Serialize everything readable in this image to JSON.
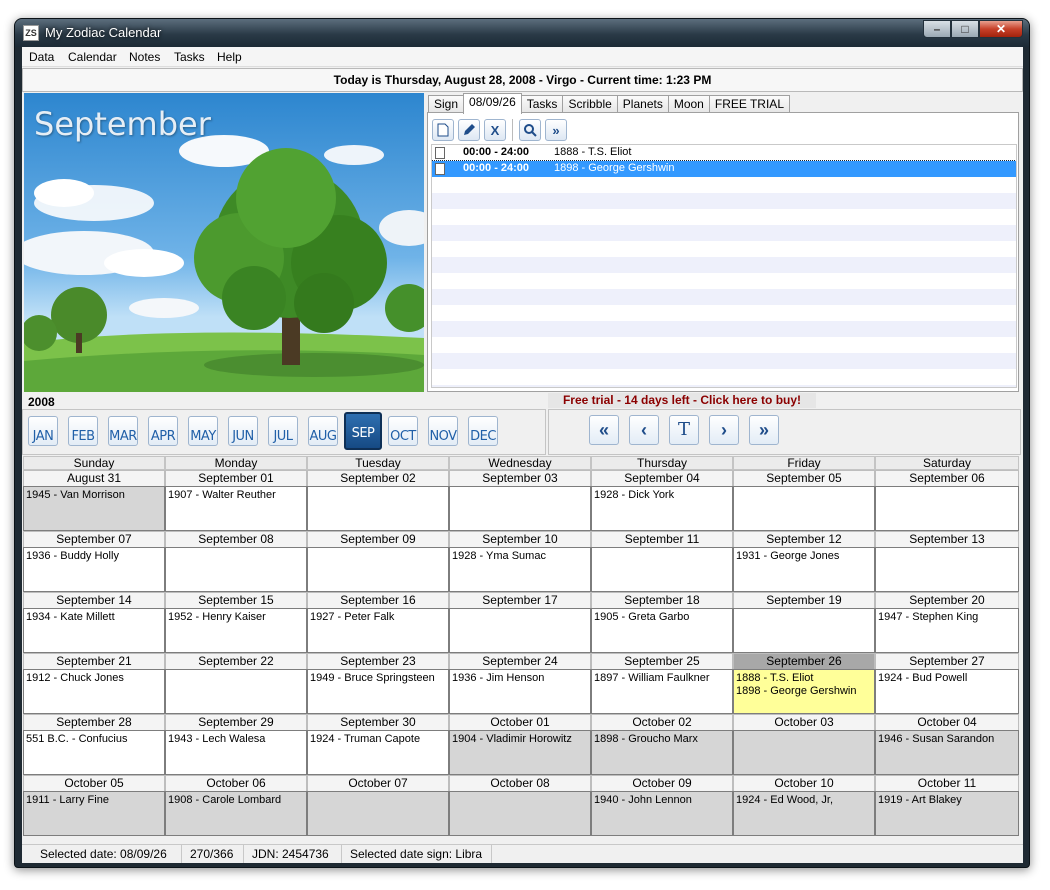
{
  "window": {
    "title": "My Zodiac Calendar",
    "icon_text": "ZS",
    "min": "–",
    "max": "□",
    "close": "✕"
  },
  "menu": [
    "Data",
    "Calendar",
    "Notes",
    "Tasks",
    "Help"
  ],
  "today_bar": "Today is Thursday, August 28, 2008 - Virgo - Current time: 1:23 PM",
  "photo": {
    "title": "September"
  },
  "tabs": [
    "Sign",
    "08/09/26",
    "Tasks",
    "Scribble",
    "Planets",
    "Moon",
    "FREE TRIAL"
  ],
  "active_tab": 1,
  "toolbar_icons": [
    "new-icon",
    "edit-icon",
    "delete-icon",
    "search-icon",
    "more-icon"
  ],
  "events": [
    {
      "time": "00:00 - 24:00",
      "text": "1888 - T.S. Eliot",
      "selected": false
    },
    {
      "time": "00:00 - 24:00",
      "text": "1898 - George Gershwin",
      "selected": true
    }
  ],
  "year": "2008",
  "trial_text": "Free trial - 14 days left - Click here to buy!",
  "months": [
    "JAN",
    "FEB",
    "MAR",
    "APR",
    "MAY",
    "JUN",
    "JUL",
    "AUG",
    "SEP",
    "OCT",
    "NOV",
    "DEC"
  ],
  "active_month": 8,
  "nav": {
    "first": "«",
    "prev": "‹",
    "today": "T",
    "next": "›",
    "last": "»"
  },
  "weekdays": [
    "Sunday",
    "Monday",
    "Tuesday",
    "Wednesday",
    "Thursday",
    "Friday",
    "Saturday"
  ],
  "weeks": [
    [
      {
        "date": "August 31",
        "text": "1945 - Van Morrison",
        "other": true
      },
      {
        "date": "September 01",
        "text": "1907 - Walter Reuther"
      },
      {
        "date": "September 02",
        "text": ""
      },
      {
        "date": "September 03",
        "text": ""
      },
      {
        "date": "September 04",
        "text": "1928 - Dick York"
      },
      {
        "date": "September 05",
        "text": ""
      },
      {
        "date": "September 06",
        "text": ""
      }
    ],
    [
      {
        "date": "September 07",
        "text": "1936 - Buddy Holly"
      },
      {
        "date": "September 08",
        "text": ""
      },
      {
        "date": "September 09",
        "text": ""
      },
      {
        "date": "September 10",
        "text": "1928 - Yma Sumac"
      },
      {
        "date": "September 11",
        "text": ""
      },
      {
        "date": "September 12",
        "text": "1931 - George Jones"
      },
      {
        "date": "September 13",
        "text": ""
      }
    ],
    [
      {
        "date": "September 14",
        "text": "1934 - Kate Millett"
      },
      {
        "date": "September 15",
        "text": "1952 - Henry Kaiser"
      },
      {
        "date": "September 16",
        "text": "1927 - Peter Falk"
      },
      {
        "date": "September 17",
        "text": ""
      },
      {
        "date": "September 18",
        "text": "1905 - Greta Garbo"
      },
      {
        "date": "September 19",
        "text": ""
      },
      {
        "date": "September 20",
        "text": "1947 - Stephen King"
      }
    ],
    [
      {
        "date": "September 21",
        "text": "1912 - Chuck Jones"
      },
      {
        "date": "September 22",
        "text": ""
      },
      {
        "date": "September 23",
        "text": "1949 - Bruce Springsteen"
      },
      {
        "date": "September 24",
        "text": "1936 - Jim Henson"
      },
      {
        "date": "September 25",
        "text": "1897 - William Faulkner"
      },
      {
        "date": "September 26",
        "text": "1888 - T.S. Eliot",
        "text2": "1898 - George Gershwin",
        "selected": true
      },
      {
        "date": "September 27",
        "text": "1924 - Bud Powell"
      }
    ],
    [
      {
        "date": "September 28",
        "text": "551 B.C. - Confucius"
      },
      {
        "date": "September 29",
        "text": "1943 - Lech Walesa"
      },
      {
        "date": "September 30",
        "text": "1924 - Truman Capote"
      },
      {
        "date": "October 01",
        "text": "1904 - Vladimir Horowitz",
        "other": true
      },
      {
        "date": "October 02",
        "text": "1898 - Groucho Marx",
        "other": true
      },
      {
        "date": "October 03",
        "text": "",
        "other": true
      },
      {
        "date": "October 04",
        "text": "1946 - Susan Sarandon",
        "other": true
      }
    ],
    [
      {
        "date": "October 05",
        "text": "1911 - Larry Fine",
        "other": true
      },
      {
        "date": "October 06",
        "text": "1908 - Carole Lombard",
        "other": true
      },
      {
        "date": "October 07",
        "text": "",
        "other": true
      },
      {
        "date": "October 08",
        "text": "",
        "other": true
      },
      {
        "date": "October 09",
        "text": "1940 - John Lennon",
        "other": true
      },
      {
        "date": "October 10",
        "text": "1924 - Ed Wood, Jr,",
        "other": true
      },
      {
        "date": "October 11",
        "text": "1919 - Art Blakey",
        "other": true
      }
    ]
  ],
  "status": {
    "selected_date": "Selected date: 08/09/26",
    "day_of_year": "270/366",
    "jdn": "JDN: 2454736",
    "sign": "Selected date sign: Libra"
  }
}
